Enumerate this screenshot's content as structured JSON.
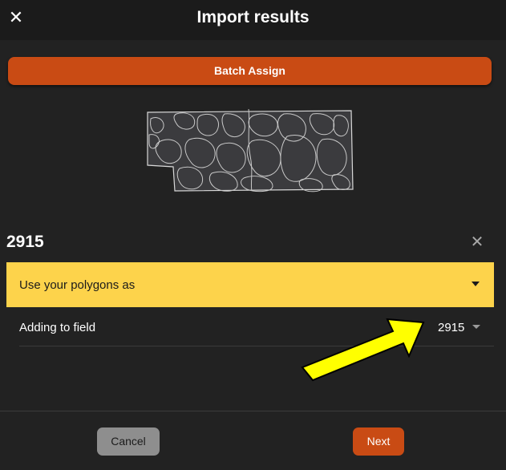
{
  "header": {
    "title": "Import results",
    "close_icon": "close-icon"
  },
  "actions": {
    "batch_assign_label": "Batch Assign"
  },
  "field": {
    "name": "2915",
    "polygons_dropdown_label": "Use your polygons as",
    "adding_to_label": "Adding to field",
    "adding_to_value": "2915"
  },
  "footer": {
    "cancel_label": "Cancel",
    "next_label": "Next"
  },
  "colors": {
    "background": "#222222",
    "accent_orange": "#c94b14",
    "dropdown_yellow": "#fdd34b",
    "annotation_arrow": "#ffff00"
  }
}
